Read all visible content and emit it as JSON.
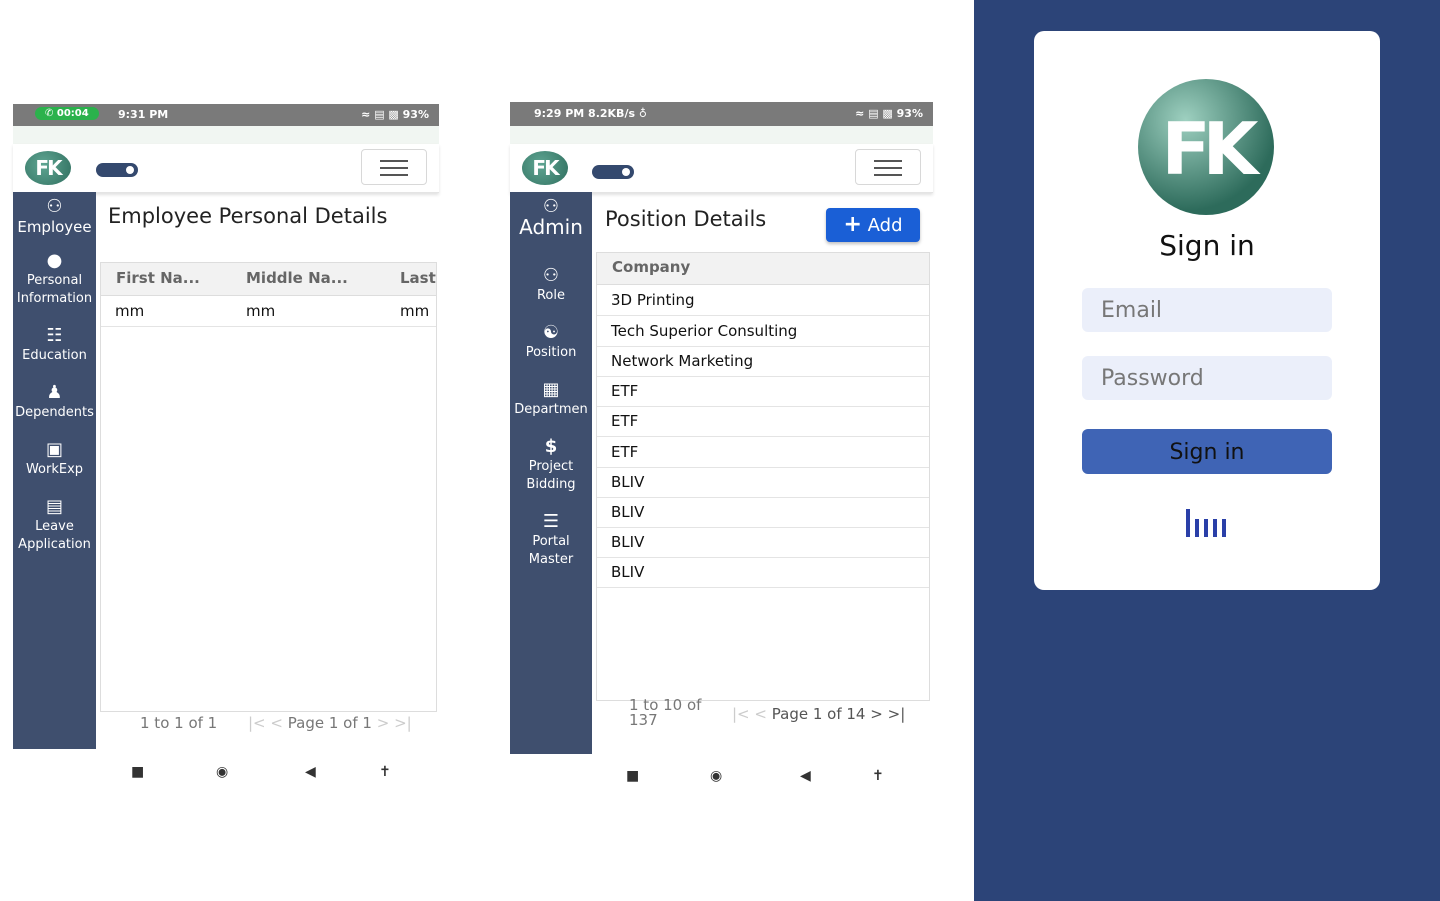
{
  "phone1": {
    "status": {
      "call_time": "00:04",
      "time": "9:31 PM",
      "battery": "93%"
    },
    "sidebar_items": [
      {
        "label": "Employee",
        "icon": "users-icon"
      },
      {
        "label": "Personal\nInformation",
        "icon": "user-icon"
      },
      {
        "label": "Education",
        "icon": "bank-icon"
      },
      {
        "label": "Dependents",
        "icon": "person-icon"
      },
      {
        "label": "WorkExp",
        "icon": "briefcase-icon"
      },
      {
        "label": "Leave\nApplication",
        "icon": "document-icon"
      }
    ],
    "title": "Employee Personal Details",
    "columns": [
      "First Na...",
      "Middle Na...",
      "Last"
    ],
    "rows": [
      [
        "mm",
        "mm",
        "mm"
      ]
    ],
    "pager_range": "1 to 1 of 1",
    "pager_page": "Page 1 of 1"
  },
  "phone2": {
    "status": {
      "time": "9:29 PM",
      "speed": "8.2KB/s",
      "battery": "93%"
    },
    "sidebar_items": [
      {
        "label": "Admin",
        "icon": "users-gear-icon"
      },
      {
        "label": "Role",
        "icon": "users-icon"
      },
      {
        "label": "Position",
        "icon": "chair-icon"
      },
      {
        "label": "Departmen",
        "icon": "building-icon"
      },
      {
        "label": "Project\nBidding",
        "icon": "dollar-icon"
      },
      {
        "label": "Portal\nMaster",
        "icon": "list-check-icon"
      }
    ],
    "title": "Position Details",
    "add_label": "Add",
    "column": "Company",
    "rows": [
      "3D Printing",
      "Tech Superior Consulting",
      "Network Marketing",
      "ETF",
      "ETF",
      "ETF",
      "BLIV",
      "BLIV",
      "BLIV",
      "BLIV"
    ],
    "pager_range": "1 to 10 of 137",
    "pager_page": "Page 1 of 14"
  },
  "login": {
    "logo_text": "FK",
    "title": "Sign in",
    "email_placeholder": "Email",
    "password_placeholder": "Password",
    "button_label": "Sign in"
  },
  "colors": {
    "sidebar": "#3f4f6e",
    "login_bg": "#2c4478",
    "primary": "#1a5fd6",
    "signin_button": "#3f64b5"
  }
}
